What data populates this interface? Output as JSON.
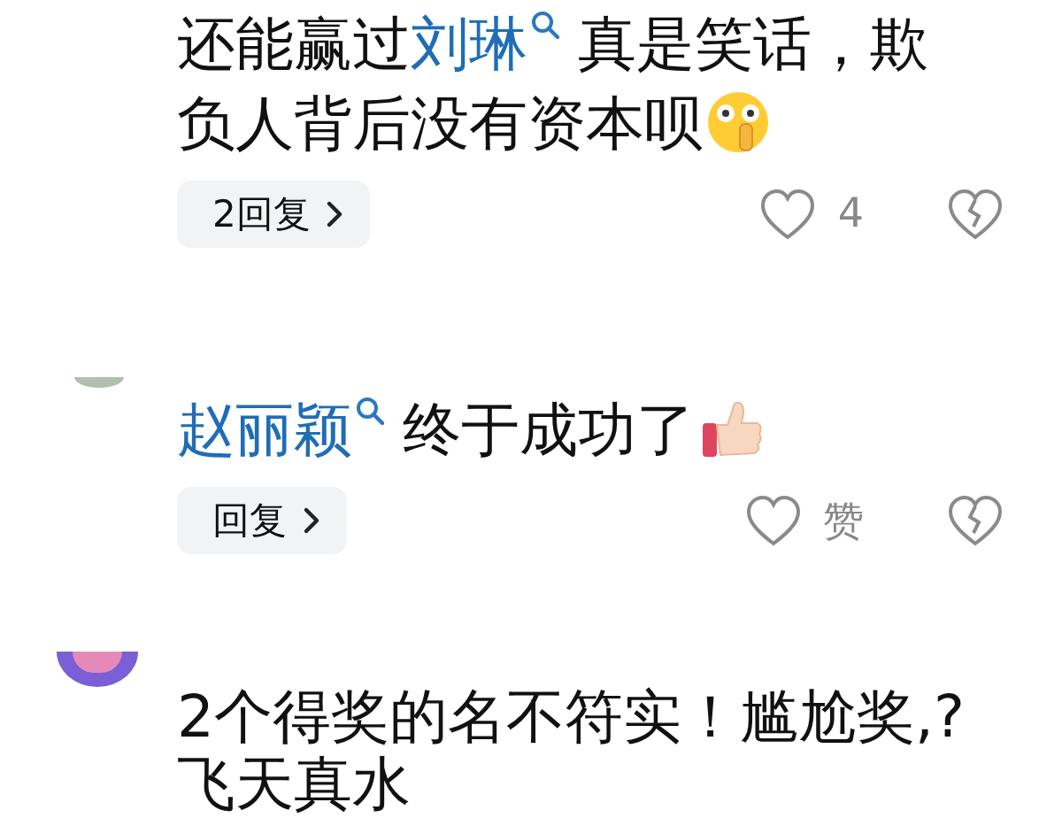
{
  "comments": [
    {
      "body": [
        {
          "kind": "text",
          "text": "还能赢过"
        },
        {
          "kind": "mention",
          "text": "刘琳"
        },
        {
          "kind": "text",
          "text": " 真是笑话，欺负人背后没有资本呗"
        },
        {
          "kind": "emoji_shush"
        }
      ],
      "reply_button": "2回复",
      "like_label": "4"
    },
    {
      "avatar": {
        "color": "#b4beb0"
      },
      "body": [
        {
          "kind": "mention",
          "text": "赵丽颖"
        },
        {
          "kind": "text",
          "text": " 终于成功了"
        },
        {
          "kind": "emoji_thumbs"
        }
      ],
      "reply_button": "回复",
      "like_label": "赞"
    },
    {
      "avatar": {
        "color": "#7a5fd6"
      },
      "body": [
        {
          "kind": "text",
          "text": "2个得奖的名不符实！尴尬奖,?飞天真水"
        }
      ]
    }
  ]
}
